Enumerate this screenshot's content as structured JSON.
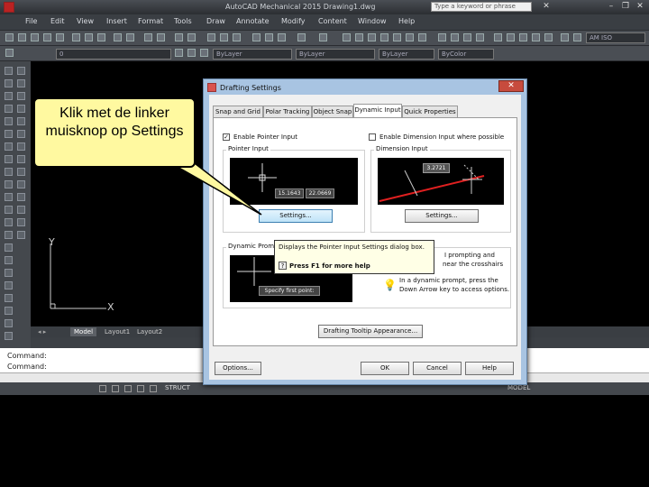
{
  "app": {
    "title": "AutoCAD Mechanical 2015  Drawing1.dwg",
    "search_placeholder": "Type a keyword or phrase"
  },
  "menu": [
    "File",
    "Edit",
    "View",
    "Insert",
    "Format",
    "Tools",
    "Draw",
    "Annotate",
    "Modify",
    "Content",
    "Window",
    "Help"
  ],
  "toolbar": {
    "layer_value": "0",
    "color_value": "ByLayer",
    "linetype_value": "ByLayer",
    "lineweight_value": "ByLayer",
    "plotstyle_value": "ByColor",
    "standard_value": "AM ISO"
  },
  "ucs": {
    "y_label": "Y",
    "x_label": "X"
  },
  "layout_tabs": [
    "Model",
    "Layout1",
    "Layout2"
  ],
  "command": {
    "line1": "Command:",
    "line2": "Command:"
  },
  "status": {
    "struct": "STRUCT",
    "model": "MODEL"
  },
  "dialog": {
    "title": "Drafting Settings",
    "tabs": [
      "Snap and Grid",
      "Polar Tracking",
      "Object Snap",
      "Dynamic Input",
      "Quick Properties"
    ],
    "selected_tab": "Dynamic Input",
    "enable_pointer_input": "Enable Pointer Input",
    "enable_dimension_input": "Enable Dimension Input where possible",
    "pointer_input_group": "Pointer Input",
    "dimension_input_group": "Dimension Input",
    "pointer_values": [
      "15.1643",
      "22.0669"
    ],
    "dimension_value": "3.2721",
    "settings_label": "Settings...",
    "settings2_label": "Settings...",
    "dynamic_prompts_group": "Dynamic Prompts",
    "prompt_text_a": "I prompting and",
    "prompt_text_b": "near the crosshairs",
    "prompt_hint_a": "In a dynamic prompt, press the",
    "prompt_hint_b": "Down Arrow key to access options.",
    "prompt_preview": "Specify first point:",
    "appearance_label": "Drafting Tooltip Appearance...",
    "options_label": "Options...",
    "ok_label": "OK",
    "cancel_label": "Cancel",
    "help_label": "Help"
  },
  "tooltip": {
    "text": "Displays the Pointer Input Settings dialog box.",
    "help": "Press F1 for more help"
  },
  "callout": {
    "text": "Klik met de linker muisknop op Settings"
  },
  "colors": {
    "callout_fill": "#fff9a0",
    "dialog_frame": "#a8c4e2",
    "close_button": "#c74b3d"
  }
}
